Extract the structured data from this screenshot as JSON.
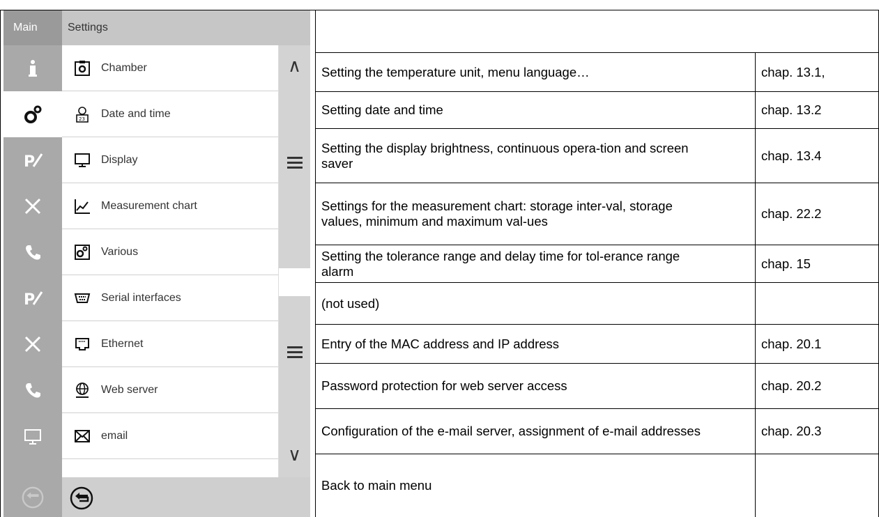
{
  "screen": {
    "tab_main": "Main",
    "tab_settings": "Settings",
    "items": [
      {
        "label": "Chamber",
        "icon": "chamber-icon"
      },
      {
        "label": "Date and time",
        "icon": "clock-calendar-icon"
      },
      {
        "label": "Display",
        "icon": "monitor-icon"
      },
      {
        "label": "Measurement chart",
        "icon": "chart-icon"
      },
      {
        "label": "Various",
        "icon": "gears-icon"
      },
      {
        "label": "Serial interfaces",
        "icon": "serial-port-icon"
      },
      {
        "label": "Ethernet",
        "icon": "ethernet-icon"
      },
      {
        "label": "Web server",
        "icon": "globe-icon"
      },
      {
        "label": "email",
        "icon": "envelope-icon"
      }
    ],
    "sidebar": [
      "info-icon",
      "settings-gears-icon",
      "program-icon",
      "tools-icon",
      "phone-icon",
      "program-icon",
      "tools-icon",
      "phone-icon",
      "monitor-icon",
      "back-icon"
    ]
  },
  "table": {
    "rows": [
      {
        "desc": "",
        "ref": ""
      },
      {
        "desc": "Setting the temperature unit, menu language…",
        "ref": "chap. 13.1,"
      },
      {
        "desc": "Setting date and time",
        "ref": "chap. 13.2"
      },
      {
        "desc": "Setting the display brightness, continuous opera-tion and screen saver",
        "ref": "chap. 13.4"
      },
      {
        "desc": "Settings for the measurement chart: storage inter-val, storage values, minimum and maximum val-ues",
        "ref": "chap. 22.2"
      },
      {
        "desc": "Setting the tolerance range and delay time for tol-erance range alarm",
        "ref": "chap. 15"
      },
      {
        "desc": "(not used)",
        "ref": ""
      },
      {
        "desc": "Entry of the MAC address and IP address",
        "ref": "chap. 20.1"
      },
      {
        "desc": "Password protection for web server access",
        "ref": "chap. 20.2"
      },
      {
        "desc": "Configuration of the e-mail server, assignment of e-mail addresses",
        "ref": "chap. 20.3"
      },
      {
        "desc": "Back to main menu",
        "ref": ""
      }
    ]
  },
  "colors": {
    "sidebar": "#a9a9a9",
    "tabbar": "#c6c6c6",
    "active": "#ffffff"
  }
}
